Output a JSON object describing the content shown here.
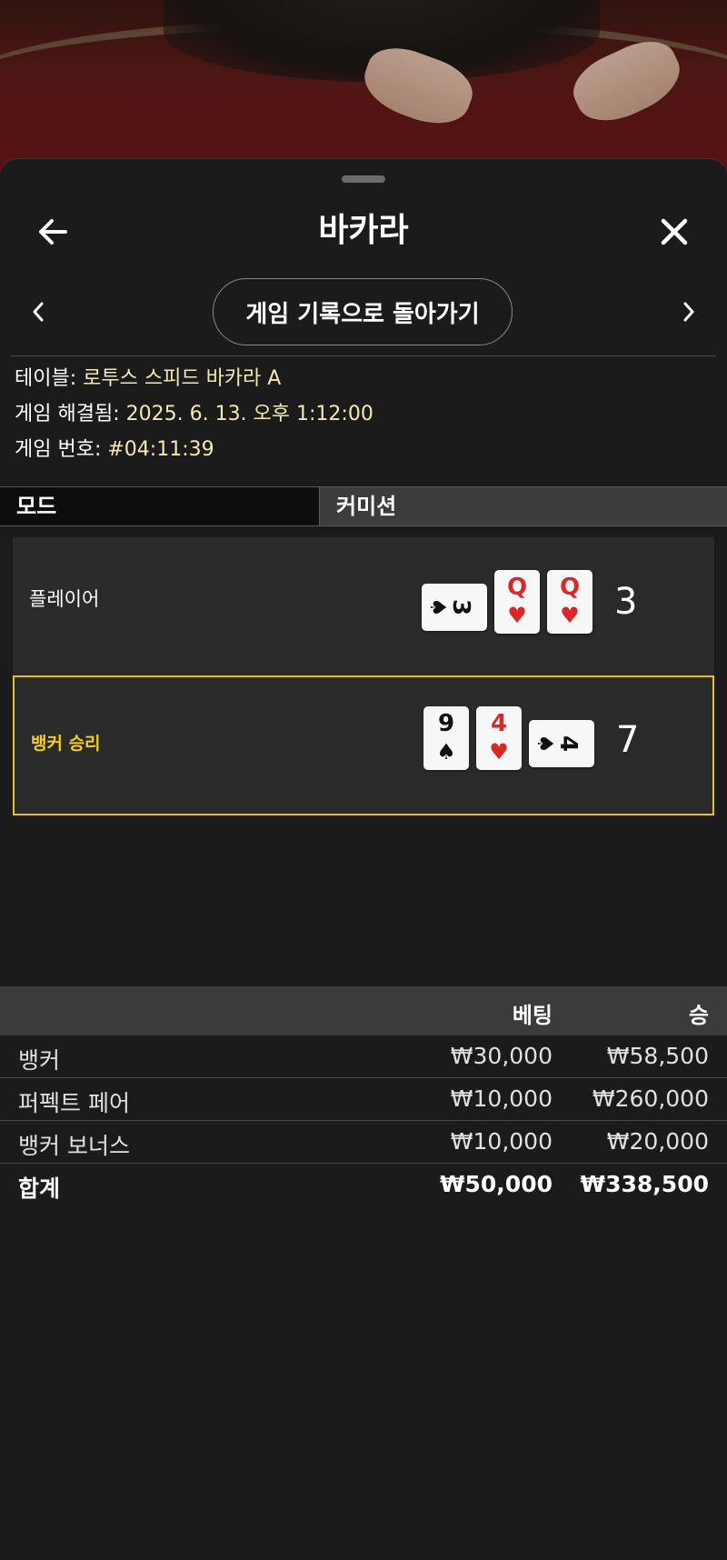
{
  "header": {
    "title": "바카라",
    "back_icon": "arrow-left-icon",
    "close_icon": "close-icon"
  },
  "nav": {
    "back_to_history_label": "게임 기록으로 돌아가기",
    "prev_icon": "chevron-left-icon",
    "next_icon": "chevron-right-icon"
  },
  "info": {
    "table_label": "테이블:",
    "table_value": "로투스 스피드 바카라 A",
    "resolved_label": "게임 해결됨:",
    "resolved_value": "2025. 6. 13. 오후 1:12:00",
    "game_no_label": "게임 번호:",
    "game_no_value": "#04:11:39"
  },
  "mode": {
    "label": "모드",
    "value": "커미션"
  },
  "results": {
    "player": {
      "label": "플레이어",
      "score": "3",
      "cards": [
        {
          "rank": "3",
          "suit": "♠",
          "color": "black",
          "orientation": "side"
        },
        {
          "rank": "Q",
          "suit": "♥",
          "color": "red",
          "orientation": "up"
        },
        {
          "rank": "Q",
          "suit": "♥",
          "color": "red",
          "orientation": "up"
        }
      ]
    },
    "banker": {
      "label": "뱅커 승리",
      "score": "7",
      "cards": [
        {
          "rank": "9",
          "suit": "♠",
          "color": "black",
          "orientation": "up"
        },
        {
          "rank": "4",
          "suit": "♥",
          "color": "red",
          "orientation": "up"
        },
        {
          "rank": "4",
          "suit": "♠",
          "color": "black",
          "orientation": "side"
        }
      ]
    }
  },
  "bets": {
    "header_bet": "베팅",
    "header_win": "승",
    "rows": [
      {
        "name": "뱅커",
        "bet": "₩30,000",
        "win": "₩58,500"
      },
      {
        "name": "퍼펙트 페어",
        "bet": "₩10,000",
        "win": "₩260,000"
      },
      {
        "name": "뱅커 보너스",
        "bet": "₩10,000",
        "win": "₩20,000"
      }
    ],
    "total": {
      "name": "합계",
      "bet": "₩50,000",
      "win": "₩338,500"
    }
  },
  "colors": {
    "accent_gold": "#e6c02c",
    "info_value": "#f3e9b5",
    "red_suit": "#d62a2a"
  }
}
